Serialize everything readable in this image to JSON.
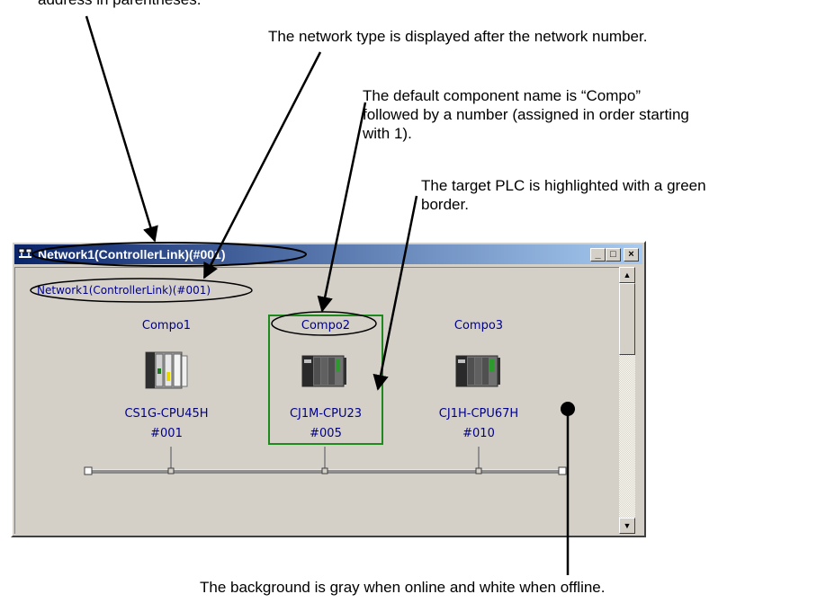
{
  "annotations": {
    "top_fragment": "address in parentheses.",
    "network_type": "The network type is displayed after the network number.",
    "component_name_1": "The default component name is “Compo”",
    "component_name_2": "followed by a number (assigned in order starting",
    "component_name_3": "with 1).",
    "target_plc_1": "The target PLC is highlighted with a green",
    "target_plc_2": "border.",
    "background": "The background is gray when online and white when offline."
  },
  "window": {
    "title": "Network1(ControllerLink)(#001)",
    "buttons": {
      "minimize": "_",
      "maximize": "□",
      "close": "×"
    }
  },
  "network_label": "Network1(ControllerLink)(#001)",
  "components": [
    {
      "name": "Compo1",
      "model": "CS1G-CPU45H",
      "address": "#001"
    },
    {
      "name": "Compo2",
      "model": "CJ1M-CPU23",
      "address": "#005"
    },
    {
      "name": "Compo3",
      "model": "CJ1H-CPU67H",
      "address": "#010"
    }
  ],
  "colors": {
    "target_border": "#1e8a1e",
    "background_online": "#d4d0c8",
    "text_blue": "#00008b"
  }
}
